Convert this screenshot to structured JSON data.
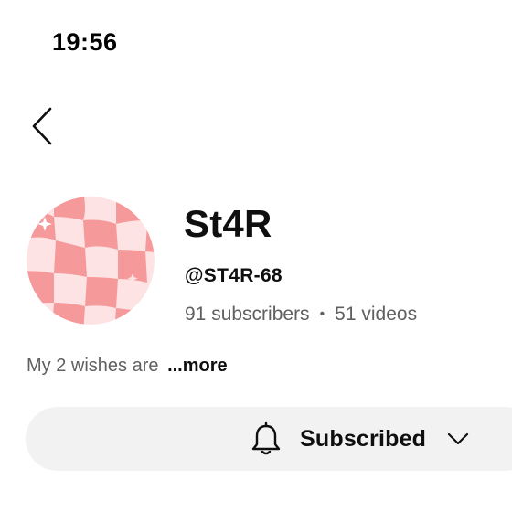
{
  "status_bar": {
    "time": "19:56"
  },
  "nav": {
    "back_icon": "chevron-left-icon"
  },
  "channel": {
    "name": "St4R",
    "handle": "@ST4R-68",
    "subscribers": "91 subscribers",
    "separator": "•",
    "videos": "51 videos",
    "description": "My 2 wishes are",
    "more_label": "...more",
    "avatar_colors": {
      "light": "#fde3e3",
      "dark": "#f6999b"
    }
  },
  "subscribe": {
    "label": "Subscribed",
    "bell_icon": "bell-icon",
    "dropdown_icon": "chevron-down-icon"
  }
}
